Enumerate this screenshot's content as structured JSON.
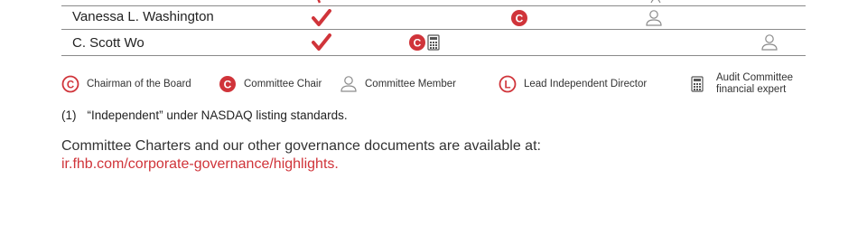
{
  "table": {
    "rows": [
      {
        "name": "Vanessa L. Washington"
      },
      {
        "name": "C. Scott Wo"
      }
    ]
  },
  "legend": {
    "chairman": "Chairman of the Board",
    "committee_chair": "Committee Chair",
    "committee_member": "Committee Member",
    "lead_independent": "Lead Independent Director",
    "audit_expert_line1": "Audit Committee",
    "audit_expert_line2": "financial expert"
  },
  "footnote": {
    "number": "(1)",
    "text": "“Independent” under NASDAQ listing standards."
  },
  "charters": {
    "text": "Committee Charters and our other governance documents are available at:",
    "link": "ir.fhb.com/corporate-governance/highlights."
  },
  "colors": {
    "accent": "#d0343a",
    "rule": "#8a8a8a",
    "icon_gray": "#8c8c8c"
  }
}
